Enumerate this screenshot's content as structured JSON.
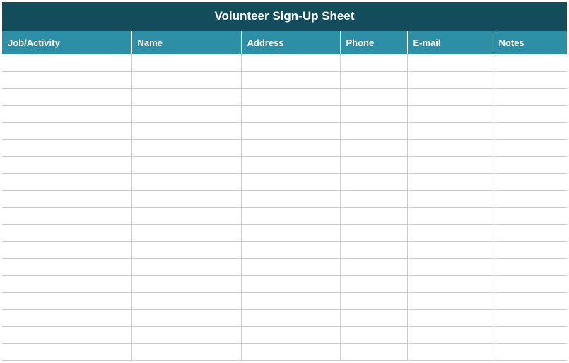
{
  "title": "Volunteer Sign-Up Sheet",
  "columns": {
    "job": "Job/Activity",
    "name": "Name",
    "address": "Address",
    "phone": "Phone",
    "email": "E-mail",
    "notes": "Notes"
  },
  "row_count": 18
}
